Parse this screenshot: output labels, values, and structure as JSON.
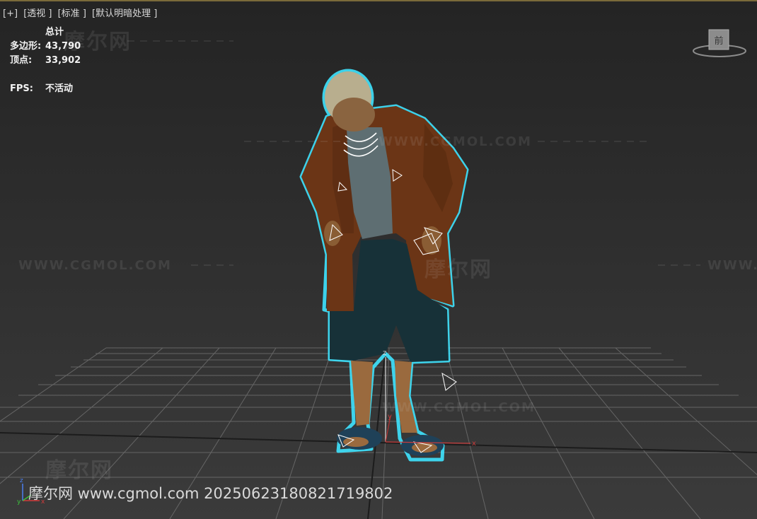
{
  "viewport": {
    "labels": [
      "[+]",
      "[透视 ]",
      "[标准 ]",
      "[默认明暗处理 ]"
    ]
  },
  "stats": {
    "total_header": "总计",
    "polys_label": "多边形:",
    "polys_value": "43,790",
    "verts_label": "顶点:",
    "verts_value": "33,902",
    "fps_label": "FPS:",
    "fps_value": "不活动"
  },
  "viewcube": {
    "face_label": "前",
    "icon": "viewcube-icon"
  },
  "axes_gizmo": {
    "x": "x",
    "y": "y",
    "z": "z"
  },
  "watermarks": {
    "url": "WWW.CGMOL.COM",
    "brand": "摩尔网"
  },
  "footer": {
    "text": "摩尔网 www.cgmol.com 20250623180821719802"
  },
  "colors": {
    "selection_outline": "#3fe4ff",
    "jacket": "#6b3516",
    "shirt": "#5e6e72",
    "shorts": "#173138",
    "skin": "#9a6a3e",
    "slipper": "#1f4158",
    "grid": "#808080"
  }
}
